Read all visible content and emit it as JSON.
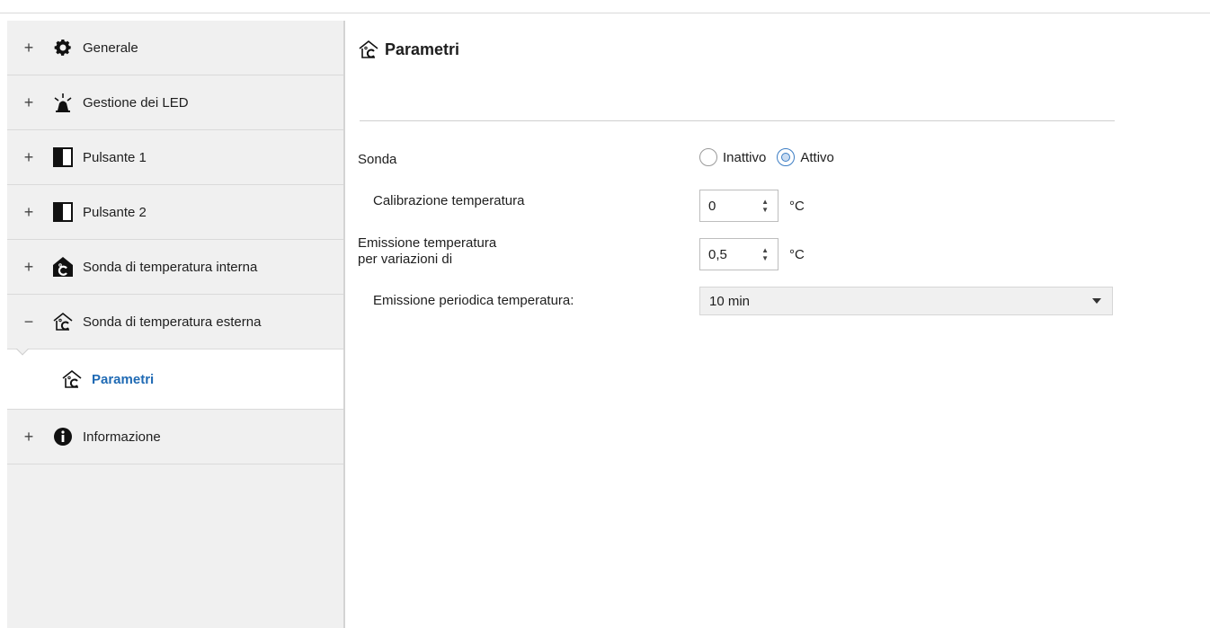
{
  "sidebar": {
    "items": [
      {
        "expander": "+",
        "icon": "gear-icon",
        "label": "Generale"
      },
      {
        "expander": "+",
        "icon": "led-light-icon",
        "label": "Gestione dei LED"
      },
      {
        "expander": "+",
        "icon": "button-icon",
        "label": "Pulsante 1"
      },
      {
        "expander": "+",
        "icon": "button-icon",
        "label": "Pulsante 2"
      },
      {
        "expander": "+",
        "icon": "house-temperature-icon",
        "label": "Sonda di temperatura interna"
      },
      {
        "expander": "−",
        "icon": "house-outline-temperature-icon",
        "label": "Sonda di temperatura esterna"
      },
      {
        "expander": "",
        "icon": "house-outline-temperature-icon",
        "label": "Parametri",
        "selected": true
      },
      {
        "expander": "+",
        "icon": "info-icon",
        "label": "Informazione"
      }
    ]
  },
  "main": {
    "title": "Parametri",
    "title_icon": "house-outline-temperature-icon",
    "sonda": {
      "label": "Sonda",
      "options": [
        "Inattivo",
        "Attivo"
      ],
      "selected": "Attivo"
    },
    "calibrazione": {
      "label": "Calibrazione temperatura",
      "value": "0",
      "unit": "°C"
    },
    "emissione_variazioni": {
      "label_line1": "Emissione temperatura",
      "label_line2": "per variazioni di",
      "value": "0,5",
      "unit": "°C"
    },
    "emissione_periodica": {
      "label": "Emissione periodica temperatura:",
      "value": "10 min"
    }
  },
  "colors": {
    "accent": "#1f6ab4",
    "sidebar_bg": "#f0f0f0",
    "radio_checked": "#3c7dc4"
  }
}
